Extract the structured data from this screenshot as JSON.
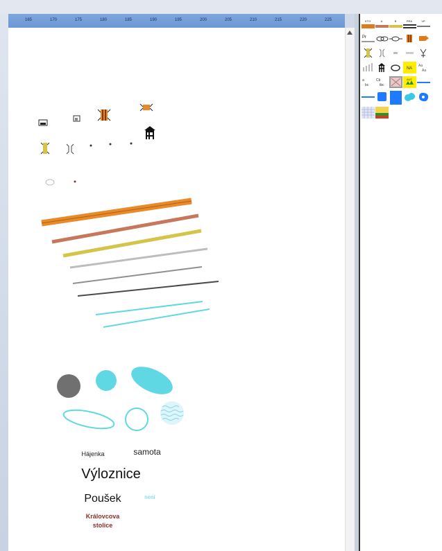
{
  "ruler": {
    "ticks": [
      "165",
      "170",
      "175",
      "180",
      "185",
      "190",
      "195",
      "200",
      "205",
      "210",
      "215",
      "220",
      "225"
    ]
  },
  "palette": {
    "swatch_labels": [
      "KTO",
      "A",
      "B",
      "PRA",
      "VP"
    ],
    "pr_label": "Pr",
    "na_label": "NA",
    "aut_label": "AUT",
    "colors": {
      "orange": "#e07a1a",
      "yellow": "#ffee00",
      "blue": "#1e7bff",
      "cyan": "#39c9e6",
      "olive": "#bfae2e",
      "gray": "#808080"
    }
  },
  "map_labels": {
    "hajenka": "Hájenka",
    "samota": "samota",
    "vyloznice": "Výloznice",
    "pousek": "Poušek",
    "neni": "není",
    "kralovcova": "Královcova",
    "stolice": "stolice"
  },
  "colors": {
    "orange_line": "#e88a2a",
    "brown_line": "#c7785a",
    "olive_line": "#d4c44a",
    "light_gray_line": "#bdbdbd",
    "gray_line": "#8f8f8f",
    "dark_line": "#4a4a4a",
    "cyan": "#5fd8e4",
    "dark_red_text": "#8b2d2d"
  }
}
